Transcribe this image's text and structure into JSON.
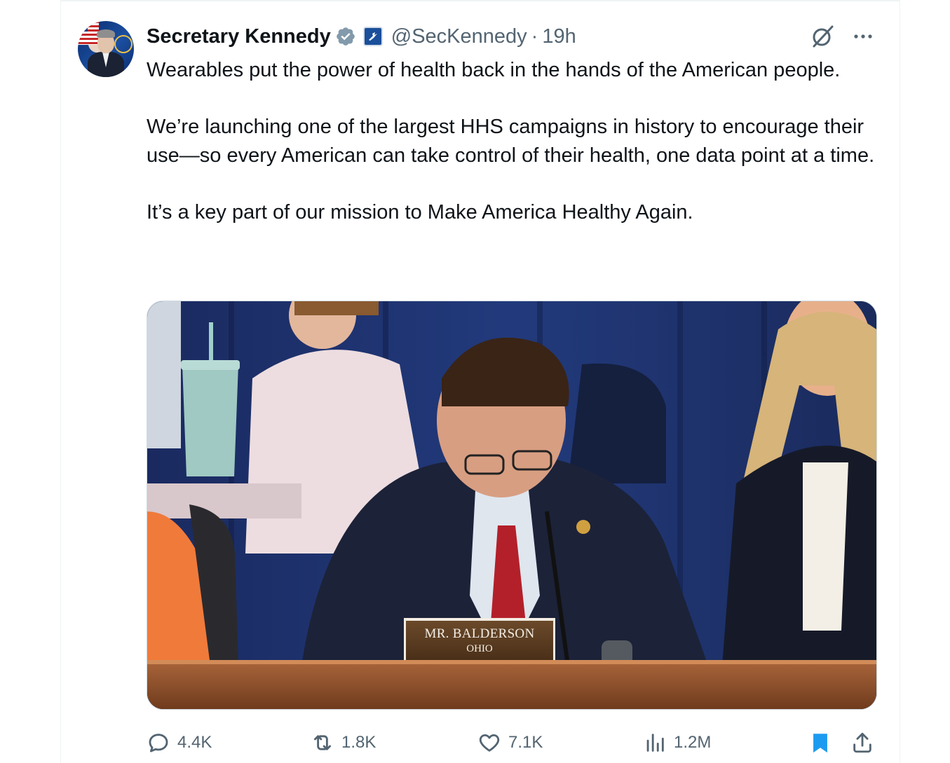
{
  "tweet": {
    "display_name": "Secretary Kennedy",
    "handle": "@SecKennedy",
    "separator": "·",
    "timestamp": "19h",
    "icons": {
      "verified": "verified-badge-icon",
      "org_badge": "hhs-affiliate-badge-icon",
      "grok": "grok-icon",
      "more": "more-options-icon"
    },
    "body": [
      "Wearables put the power of health back in the hands of the American people.",
      "We’re launching one of the largest HHS campaigns in history to encourage their use—so every American can take control of their health, one data point at a time.",
      "It’s a key part of our mission to Make America Healthy Again."
    ],
    "media": {
      "nameplate_name": "MR. BALDERSON",
      "nameplate_state": "OHIO"
    },
    "actions": {
      "replies": "4.4K",
      "reposts": "1.8K",
      "likes": "7.1K",
      "views": "1.2M"
    }
  },
  "colors": {
    "text": "#0f1419",
    "secondary": "#536471",
    "verified": "#829aab",
    "bookmark_active": "#1d9bf0",
    "border": "#cfd9de"
  }
}
